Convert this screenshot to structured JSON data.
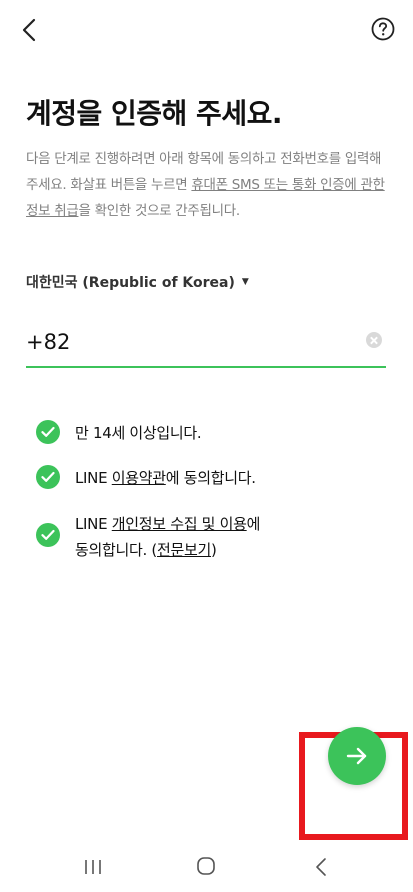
{
  "header": {
    "back_icon": "back-arrow-icon",
    "help_icon": "question-circle-icon"
  },
  "title": "계정을 인증해 주세요.",
  "description": {
    "part1": "다음 단계로 진행하려면 아래 항목에 동의하고 전화번호를 입력해 주세요. 화살표 버튼을 누르면 ",
    "link": "휴대폰 SMS 또는 통화 인증에 관한 정보 취급",
    "part2": "을 확인한 것으로 간주됩니다."
  },
  "country": {
    "label": "대한민국 (Republic of Korea)",
    "caret": "▼"
  },
  "phone": {
    "value": "+82",
    "placeholder": ""
  },
  "agreements": [
    {
      "text": "만 14세 이상입니다."
    },
    {
      "prefix": "LINE ",
      "link": "이용약관",
      "suffix": "에 동의합니다."
    },
    {
      "prefix": "LINE ",
      "link": "개인정보 수집 및 이용",
      "suffix": "에",
      "line2_prefix": "동의합니다. (",
      "line2_link": "전문보기",
      "line2_suffix": ")"
    }
  ],
  "next_button": {
    "icon": "arrow-right-icon"
  },
  "colors": {
    "accent": "#3cc35a",
    "highlight": "#e8191e",
    "muted": "#808080"
  }
}
